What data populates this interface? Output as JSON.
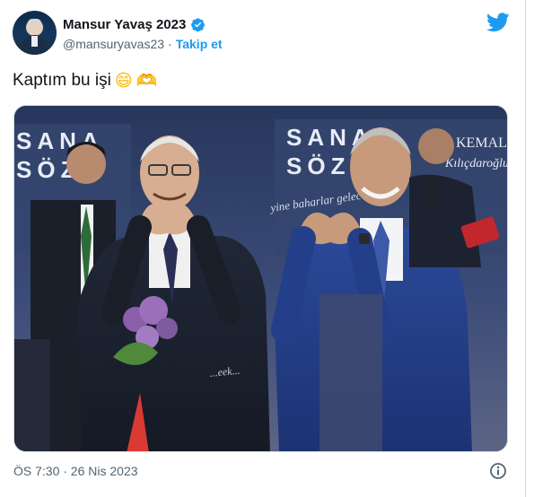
{
  "tweet": {
    "author": {
      "display_name": "Mansur Yavaş 2023",
      "handle": "@mansuryavas23",
      "separator": "·",
      "follow_label": "Takip et",
      "verified": true
    },
    "text": "Kaptım bu işi",
    "emojis": [
      "😄",
      "🫶"
    ],
    "timestamp": "ÖS 7:30 · 26 Nis 2023",
    "media": {
      "banner_text_left": [
        "SANA",
        "SÖZ"
      ],
      "banner_text_right": [
        "SANA",
        "SÖZ"
      ],
      "banner_signature": "KEMAL",
      "banner_script": "Kılıçdaroğlu",
      "banner_slogan": "yine baharlar gelecek..."
    }
  },
  "colors": {
    "accent": "#1d9bf0",
    "text": "#0f1419",
    "muted": "#536471"
  },
  "icons": {
    "brand": "twitter-bird-icon",
    "verified": "verified-badge-icon",
    "info": "info-circle-icon"
  }
}
